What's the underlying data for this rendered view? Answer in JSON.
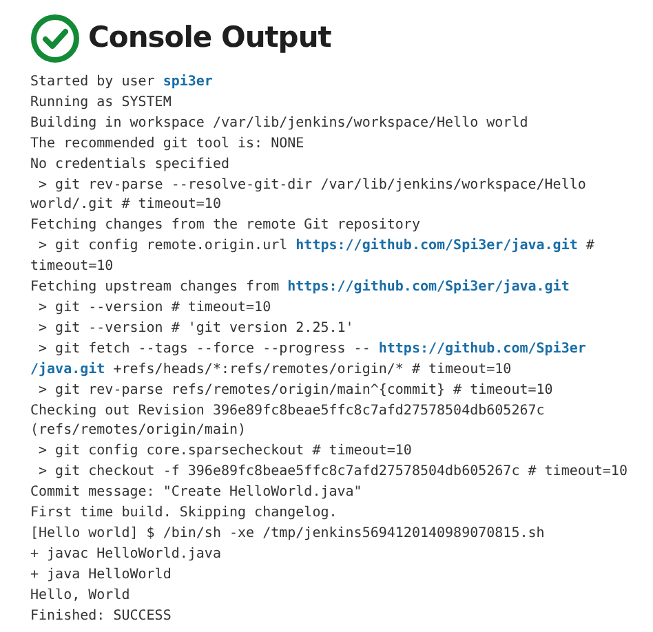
{
  "header": {
    "title": "Console Output"
  },
  "lines": [
    [
      {
        "kind": "text",
        "text": "Started by user "
      },
      {
        "kind": "link",
        "text": "spi3er"
      }
    ],
    [
      {
        "kind": "text",
        "text": "Running as SYSTEM"
      }
    ],
    [
      {
        "kind": "text",
        "text": "Building in workspace /var/lib/jenkins/workspace/Hello world"
      }
    ],
    [
      {
        "kind": "text",
        "text": "The recommended git tool is: NONE"
      }
    ],
    [
      {
        "kind": "text",
        "text": "No credentials specified"
      }
    ],
    [
      {
        "kind": "text",
        "text": " > git rev-parse --resolve-git-dir /var/lib/jenkins/workspace/Hello"
      }
    ],
    [
      {
        "kind": "text",
        "text": "world/.git # timeout=10"
      }
    ],
    [
      {
        "kind": "text",
        "text": "Fetching changes from the remote Git repository"
      }
    ],
    [
      {
        "kind": "text",
        "text": " > git config remote.origin.url "
      },
      {
        "kind": "link",
        "text": "https://github.com/Spi3er/java.git"
      },
      {
        "kind": "text",
        "text": " #"
      }
    ],
    [
      {
        "kind": "text",
        "text": "timeout=10"
      }
    ],
    [
      {
        "kind": "text",
        "text": "Fetching upstream changes from "
      },
      {
        "kind": "link",
        "text": "https://github.com/Spi3er/java.git"
      }
    ],
    [
      {
        "kind": "text",
        "text": " > git --version # timeout=10"
      }
    ],
    [
      {
        "kind": "text",
        "text": " > git --version # 'git version 2.25.1'"
      }
    ],
    [
      {
        "kind": "text",
        "text": " > git fetch --tags --force --progress -- "
      },
      {
        "kind": "link",
        "text": "https://github.com/Spi3er"
      }
    ],
    [
      {
        "kind": "link",
        "text": "/java.git"
      },
      {
        "kind": "text",
        "text": " +refs/heads/*:refs/remotes/origin/* # timeout=10"
      }
    ],
    [
      {
        "kind": "text",
        "text": " > git rev-parse refs/remotes/origin/main^{commit} # timeout=10"
      }
    ],
    [
      {
        "kind": "text",
        "text": "Checking out Revision 396e89fc8beae5ffc8c7afd27578504db605267c"
      }
    ],
    [
      {
        "kind": "text",
        "text": "(refs/remotes/origin/main)"
      }
    ],
    [
      {
        "kind": "text",
        "text": " > git config core.sparsecheckout # timeout=10"
      }
    ],
    [
      {
        "kind": "text",
        "text": " > git checkout -f 396e89fc8beae5ffc8c7afd27578504db605267c # timeout=10"
      }
    ],
    [
      {
        "kind": "text",
        "text": "Commit message: \"Create HelloWorld.java\""
      }
    ],
    [
      {
        "kind": "text",
        "text": "First time build. Skipping changelog."
      }
    ],
    [
      {
        "kind": "text",
        "text": "[Hello world] $ /bin/sh -xe /tmp/jenkins5694120140989070815.sh"
      }
    ],
    [
      {
        "kind": "text",
        "text": "+ javac HelloWorld.java"
      }
    ],
    [
      {
        "kind": "text",
        "text": "+ java HelloWorld"
      }
    ],
    [
      {
        "kind": "text",
        "text": "Hello, World"
      }
    ],
    [
      {
        "kind": "text",
        "text": "Finished: SUCCESS"
      }
    ]
  ]
}
